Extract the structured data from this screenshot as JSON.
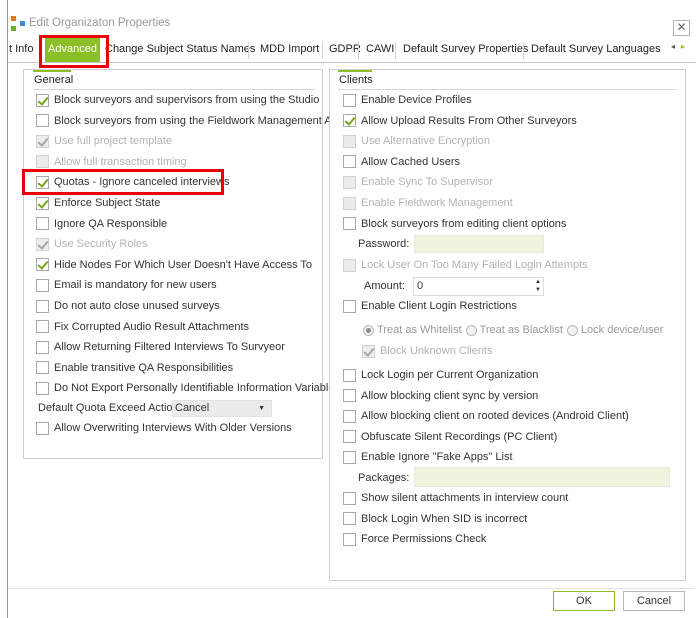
{
  "window": {
    "title": "Edit Organizaton Properties",
    "close_glyph": "✕"
  },
  "tabs": [
    {
      "label": "t Info"
    },
    {
      "label": "Advanced",
      "active": true
    },
    {
      "label": "Change Subject Status Names"
    },
    {
      "label": "MDD Import"
    },
    {
      "label": "GDPR"
    },
    {
      "label": "CAWI"
    },
    {
      "label": "Default Survey Properties"
    },
    {
      "label": "Default Survey Languages"
    }
  ],
  "tab_scroll": {
    "left_icon": "chevron-left-icon",
    "right_icon": "chevron-right-icon",
    "glyph_left": "◂",
    "glyph_right": "▸"
  },
  "general": {
    "header": "General",
    "items": [
      {
        "label": "Block surveyors and supervisors from using the Studio",
        "checked": true,
        "disabled": false
      },
      {
        "label": "Block surveyors from using the  Fieldwork Management App",
        "checked": false,
        "disabled": false
      },
      {
        "label": "Use full project template",
        "checked": true,
        "disabled": true
      },
      {
        "label": "Allow full transaction timing",
        "checked": false,
        "disabled": true
      },
      {
        "label": "Quotas - Ignore canceled interviews",
        "checked": true,
        "disabled": false
      },
      {
        "label": "Enforce Subject State",
        "checked": true,
        "disabled": false
      },
      {
        "label": "Ignore QA Responsible",
        "checked": false,
        "disabled": false
      },
      {
        "label": "Use Security Roles",
        "checked": true,
        "disabled": true
      },
      {
        "label": "Hide Nodes For Which User Doesn't Have Access To",
        "checked": true,
        "disabled": false
      },
      {
        "label": "Email is mandatory for new users",
        "checked": false,
        "disabled": false
      },
      {
        "label": "Do not auto close unused surveys",
        "checked": false,
        "disabled": false
      },
      {
        "label": "Fix Corrupted Audio Result Attachments",
        "checked": false,
        "disabled": false
      },
      {
        "label": "Allow Returning Filtered Interviews To Survyeor",
        "checked": false,
        "disabled": false
      },
      {
        "label": "Enable transitive QA Responsibilities",
        "checked": false,
        "disabled": false
      },
      {
        "label": "Do Not Export Personally Identifiable Information Variables",
        "checked": false,
        "disabled": false
      }
    ],
    "quota_action": {
      "label": "Default Quota Exceed Action:",
      "value": "Cancel",
      "arrow": "▼"
    },
    "last_item": {
      "label": "Allow Overwriting Interviews With Older Versions",
      "checked": false,
      "disabled": false
    }
  },
  "clients": {
    "header": "Clients",
    "items_a": [
      {
        "label": "Enable Device Profiles",
        "checked": false,
        "disabled": false
      },
      {
        "label": "Allow Upload Results From Other Surveyors",
        "checked": true,
        "disabled": false
      },
      {
        "label": "Use Alternative Encryption",
        "checked": false,
        "disabled": true
      },
      {
        "label": "Allow Cached Users",
        "checked": false,
        "disabled": false
      },
      {
        "label": "Enable Sync To Supervisor",
        "checked": false,
        "disabled": true
      },
      {
        "label": "Enable Fieldwork Management",
        "checked": false,
        "disabled": true
      },
      {
        "label": "Block surveyors from editing client options",
        "checked": false,
        "disabled": false
      }
    ],
    "password_label": "Password:",
    "lockout": {
      "label": "Lock User On Too Many Failed Login Attempts",
      "checked": false,
      "disabled": true
    },
    "amount": {
      "label": "Amount:",
      "value": "0",
      "up": "▲",
      "down": "▼"
    },
    "login_restrictions": {
      "label": "Enable Client Login Restrictions",
      "checked": false,
      "disabled": false
    },
    "radios": [
      {
        "label": "Treat as Whitelist",
        "selected": true
      },
      {
        "label": "Treat as Blacklist",
        "selected": false
      },
      {
        "label": "Lock device/user",
        "selected": false
      }
    ],
    "block_unknown": {
      "label": "Block Unknown Clients",
      "checked": true,
      "disabled": true
    },
    "items_b": [
      {
        "label": "Lock Login per Current Organization",
        "checked": false,
        "disabled": false
      },
      {
        "label": "Allow blocking client sync by version",
        "checked": false,
        "disabled": false
      },
      {
        "label": "Allow blocking client on rooted devices (Android Client)",
        "checked": false,
        "disabled": false
      },
      {
        "label": "Obfuscate Silent Recordings (PC Client)",
        "checked": false,
        "disabled": false
      },
      {
        "label": "Enable Ignore \"Fake Apps\" List",
        "checked": false,
        "disabled": false
      }
    ],
    "packages_label": "Packages:",
    "items_c": [
      {
        "label": "Show silent attachments in interview count",
        "checked": false,
        "disabled": false
      },
      {
        "label": "Block Login When SID is incorrect",
        "checked": false,
        "disabled": false
      },
      {
        "label": "Force Permissions Check",
        "checked": false,
        "disabled": false
      }
    ]
  },
  "buttons": {
    "ok": "OK",
    "cancel": "Cancel"
  },
  "colors": {
    "accent": "#8cbf26",
    "highlight": "#e8000a"
  }
}
